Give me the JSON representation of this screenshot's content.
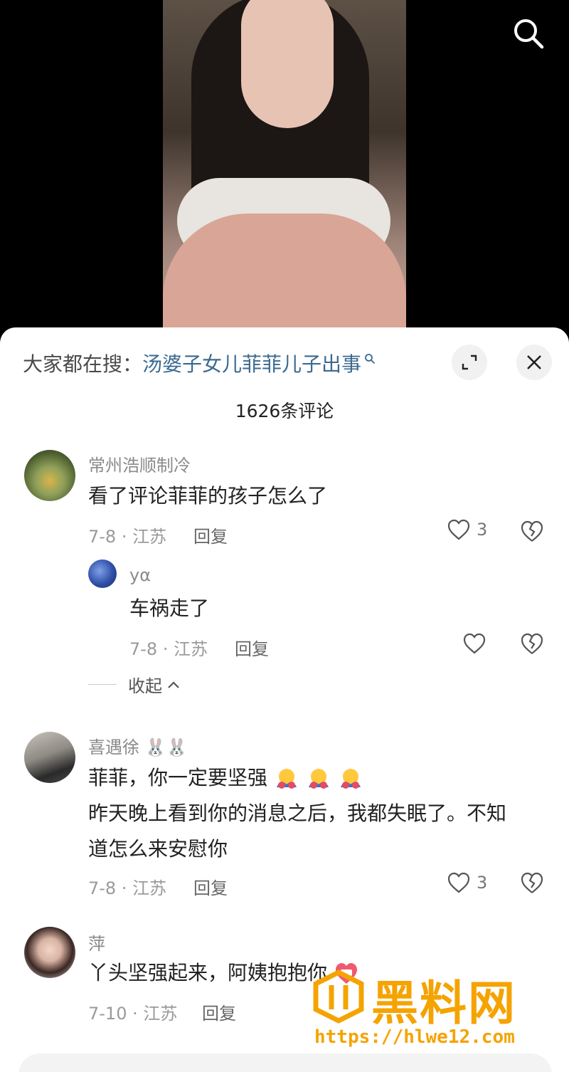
{
  "hot_search": {
    "prefix": "大家都在搜：",
    "term": "汤婆子女儿菲菲儿子出事"
  },
  "comment_count": "1626条评论",
  "comments": [
    {
      "user": "常州浩顺制冷",
      "text": [
        "看了评论菲菲的孩子怎么了"
      ],
      "date_location": "7-8 · 江苏",
      "reply_label": "回复",
      "likes": "3"
    },
    {
      "user": "yα",
      "text": [
        "车祸走了"
      ],
      "date_location": "7-8 · 江苏",
      "reply_label": "回复",
      "likes": ""
    },
    {
      "user": "喜遇徐",
      "text": [
        "菲菲，你一定要坚强",
        "昨天晚上看到你的消息之后，我都失眠了。不知",
        "道怎么来安慰你"
      ],
      "date_location": "7-8 · 江苏",
      "reply_label": "回复",
      "likes": "3"
    },
    {
      "user": "萍",
      "text": [
        "丫头坚强起来，阿姨抱抱你"
      ],
      "date_location": "7-10 · 江苏",
      "reply_label": "回复",
      "likes": ""
    }
  ],
  "collapse_label": "收起",
  "watermark": {
    "title": "黑料网",
    "url": "https://hlwe12.com"
  },
  "colors": {
    "link": "#3b6a8f",
    "watermark": "#f5a300"
  }
}
